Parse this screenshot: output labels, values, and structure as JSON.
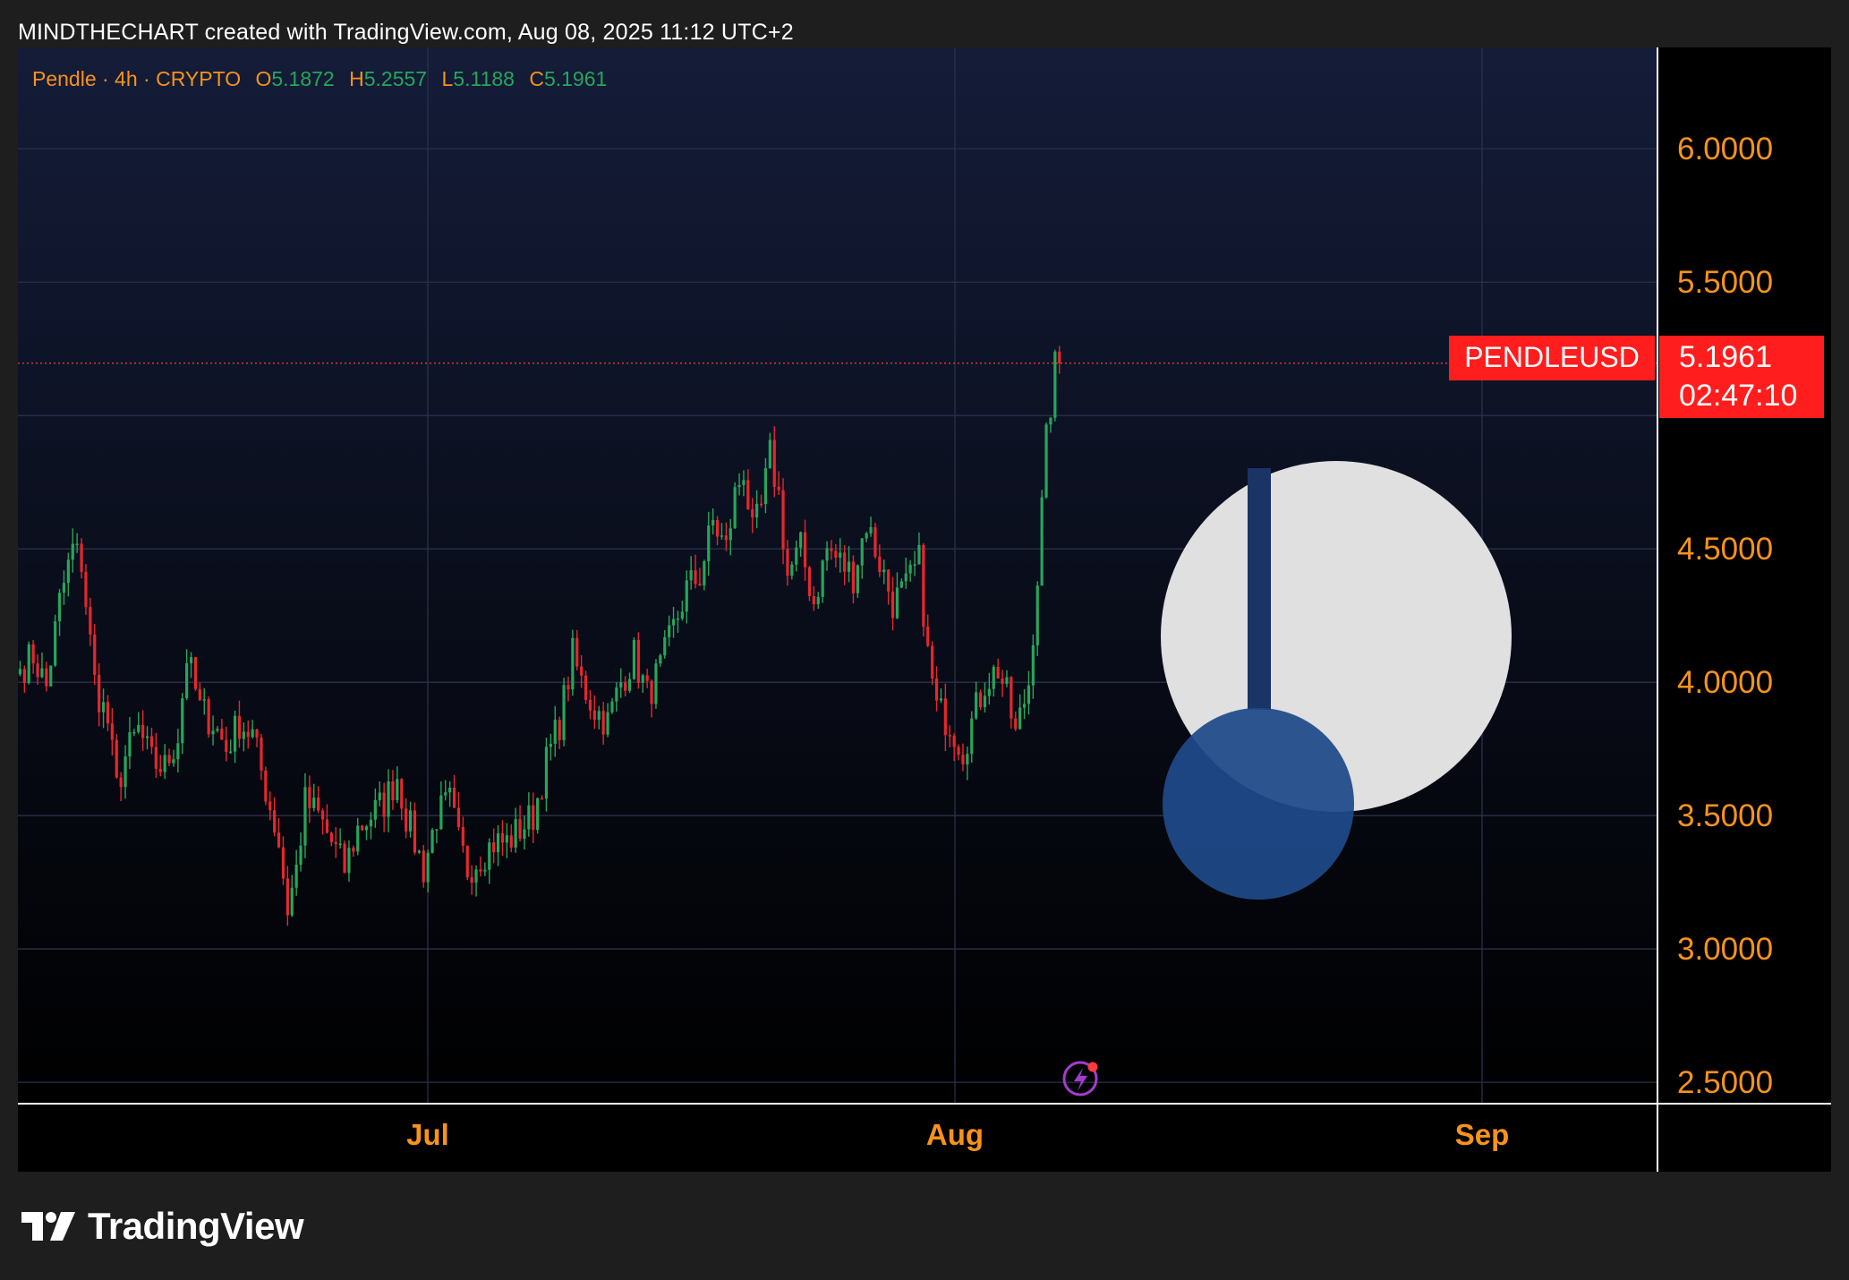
{
  "header": {
    "attribution": "MINDTHECHART created with TradingView.com, Aug 08, 2025 11:12 UTC+2"
  },
  "legend": {
    "symbol": "Pendle · 4h · CRYPTO",
    "o_label": "O",
    "o_value": "5.1872",
    "h_label": "H",
    "h_value": "5.2557",
    "l_label": "L",
    "l_value": "5.1188",
    "c_label": "C",
    "c_value": "5.1961"
  },
  "price_tag": {
    "ticker": "PENDLEUSD",
    "price": "5.1961",
    "countdown": "02:47:10"
  },
  "footer": {
    "brand": "TradingView"
  },
  "colors": {
    "up": "#26a65b",
    "down": "#e8262d",
    "axis_text": "#f7931a",
    "price_tag_bg": "#ff1d1d",
    "watermark_light": "#e0e0e0",
    "watermark_dark": "#1e4a8a"
  },
  "chart_data": {
    "type": "candlestick",
    "interval": "4h",
    "y_ticks": [
      "6.0000",
      "5.5000",
      "4.5000",
      "4.0000",
      "3.5000",
      "3.0000",
      "2.5000"
    ],
    "x_ticks": [
      "Jul",
      "Aug",
      "Sep"
    ],
    "ylim": [
      2.42,
      6.38
    ],
    "last_price": 5.1961,
    "grid": true,
    "close_path": [
      [
        0,
        4.05
      ],
      [
        3,
        4.1
      ],
      [
        6,
        3.98
      ],
      [
        9,
        4.3
      ],
      [
        12,
        4.5
      ],
      [
        14,
        4.45
      ],
      [
        17,
        4.0
      ],
      [
        20,
        3.85
      ],
      [
        22,
        3.6
      ],
      [
        24,
        3.72
      ],
      [
        27,
        3.82
      ],
      [
        30,
        3.7
      ],
      [
        33,
        3.68
      ],
      [
        36,
        3.8
      ],
      [
        38,
        4.1
      ],
      [
        41,
        3.9
      ],
      [
        44,
        3.85
      ],
      [
        47,
        3.75
      ],
      [
        50,
        3.85
      ],
      [
        53,
        3.8
      ],
      [
        56,
        3.6
      ],
      [
        59,
        3.4
      ],
      [
        61,
        3.15
      ],
      [
        63,
        3.3
      ],
      [
        65,
        3.55
      ],
      [
        68,
        3.5
      ],
      [
        71,
        3.4
      ],
      [
        74,
        3.3
      ],
      [
        77,
        3.45
      ],
      [
        80,
        3.5
      ],
      [
        83,
        3.55
      ],
      [
        86,
        3.65
      ],
      [
        88,
        3.5
      ],
      [
        90,
        3.4
      ],
      [
        92,
        3.3
      ],
      [
        95,
        3.5
      ],
      [
        98,
        3.55
      ],
      [
        100,
        3.4
      ],
      [
        102,
        3.3
      ],
      [
        105,
        3.35
      ],
      [
        108,
        3.4
      ],
      [
        111,
        3.4
      ],
      [
        114,
        3.45
      ],
      [
        117,
        3.5
      ],
      [
        120,
        3.7
      ],
      [
        123,
        3.85
      ],
      [
        126,
        4.1
      ],
      [
        128,
        4.0
      ],
      [
        131,
        3.9
      ],
      [
        134,
        3.85
      ],
      [
        137,
        4.0
      ],
      [
        140,
        4.1
      ],
      [
        143,
        3.95
      ],
      [
        146,
        4.05
      ],
      [
        149,
        4.2
      ],
      [
        152,
        4.35
      ],
      [
        155,
        4.4
      ],
      [
        158,
        4.6
      ],
      [
        161,
        4.5
      ],
      [
        163,
        4.7
      ],
      [
        165,
        4.8
      ],
      [
        167,
        4.55
      ],
      [
        169,
        4.65
      ],
      [
        171,
        4.85
      ],
      [
        173,
        4.7
      ],
      [
        175,
        4.4
      ],
      [
        178,
        4.5
      ],
      [
        181,
        4.3
      ],
      [
        184,
        4.5
      ],
      [
        187,
        4.45
      ],
      [
        190,
        4.4
      ],
      [
        193,
        4.6
      ],
      [
        196,
        4.45
      ],
      [
        199,
        4.3
      ],
      [
        202,
        4.35
      ],
      [
        205,
        4.45
      ],
      [
        207,
        4.1
      ],
      [
        209,
        3.9
      ],
      [
        212,
        3.85
      ],
      [
        215,
        3.75
      ],
      [
        217,
        3.85
      ],
      [
        220,
        4.0
      ],
      [
        223,
        4.05
      ],
      [
        225,
        3.95
      ],
      [
        227,
        3.8
      ],
      [
        230,
        4.0
      ],
      [
        232,
        4.4
      ],
      [
        234,
        4.9
      ],
      [
        236,
        5.18
      ],
      [
        237,
        5.2
      ]
    ]
  }
}
